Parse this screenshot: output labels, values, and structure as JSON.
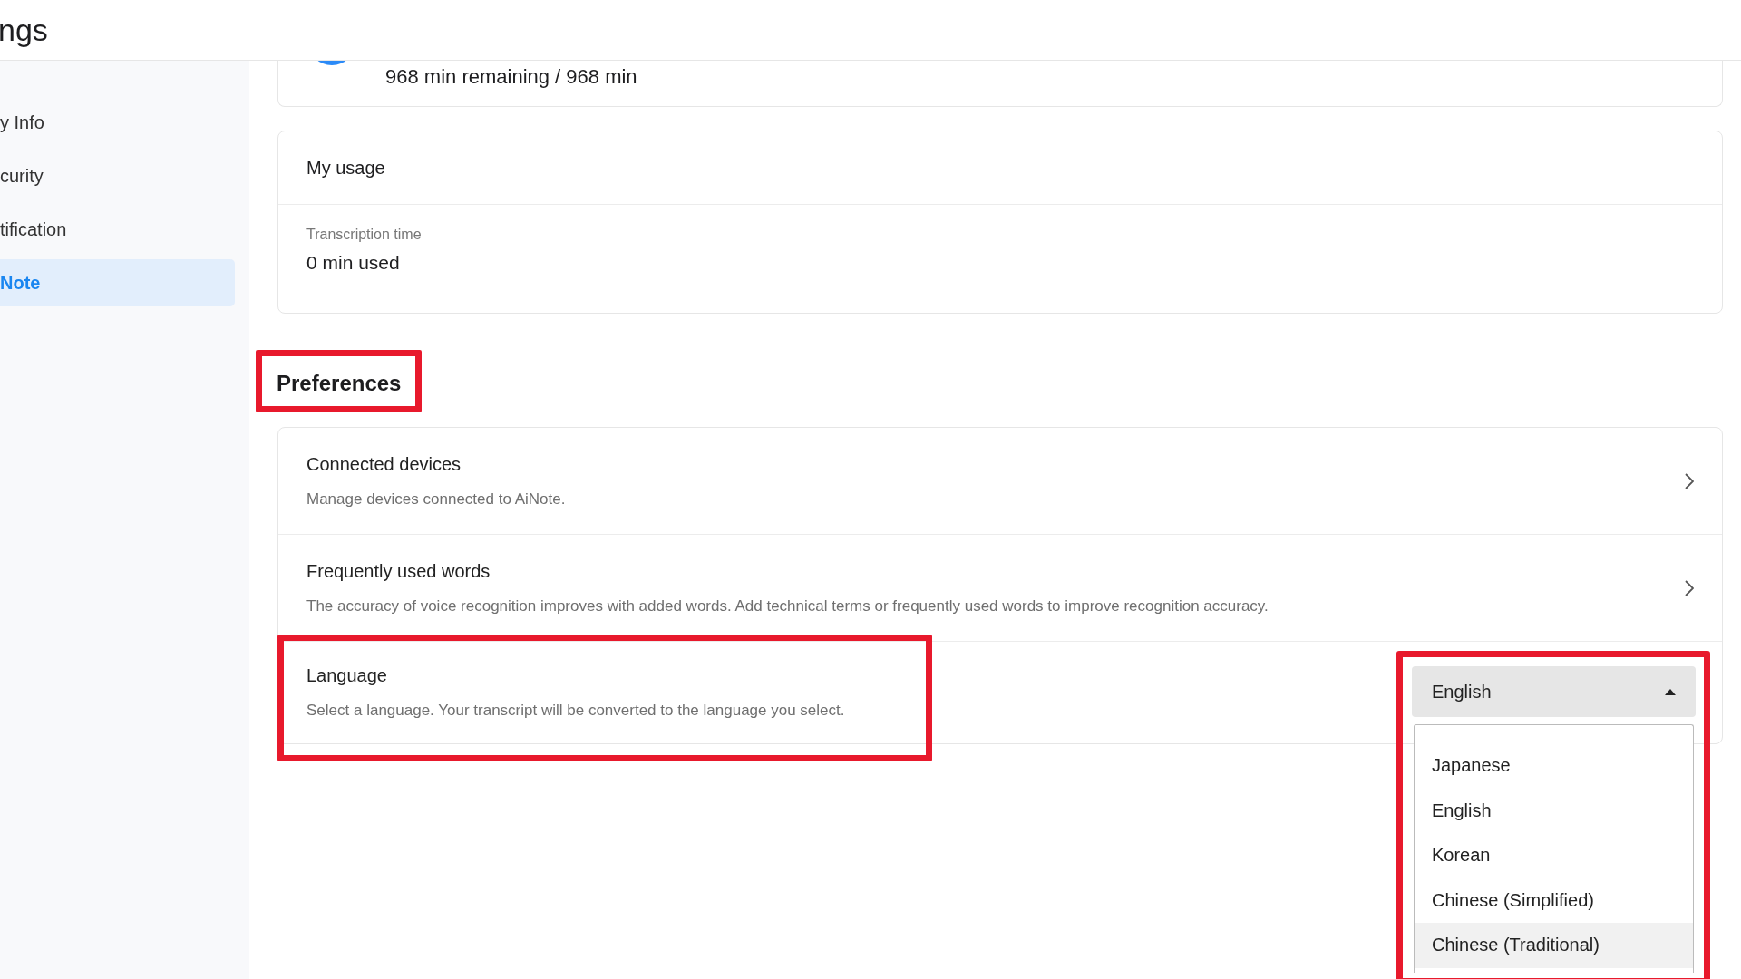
{
  "header": {
    "title": "ngs"
  },
  "sidebar": {
    "items": [
      {
        "label": "y Info",
        "selected": false
      },
      {
        "label": "curity",
        "selected": false
      },
      {
        "label": "tification",
        "selected": false
      },
      {
        "label": "Note",
        "selected": true
      }
    ]
  },
  "plan": {
    "remaining": "968 min remaining / 968 min"
  },
  "usage": {
    "title": "My usage",
    "label": "Transcription time",
    "value": "0 min used"
  },
  "preferences": {
    "heading": "Preferences",
    "annotated": true,
    "rows": [
      {
        "kind": "link",
        "title": "Connected devices",
        "description": "Manage devices connected to AiNote.",
        "annotated": false
      },
      {
        "kind": "link",
        "title": "Frequently used words",
        "description": "The accuracy of voice recognition improves with added words. Add technical terms or frequently used words to improve recognition accuracy.",
        "annotated": false
      },
      {
        "kind": "select",
        "title": "Language",
        "description": "Select a language. Your transcript will be converted to the language you select.",
        "annotated": true,
        "select": {
          "value": "English",
          "expanded": true,
          "annotated": true,
          "options": [
            {
              "label": "Japanese",
              "highlighted": false
            },
            {
              "label": "English",
              "highlighted": false
            },
            {
              "label": "Korean",
              "highlighted": false
            },
            {
              "label": "Chinese (Simplified)",
              "highlighted": false
            },
            {
              "label": "Chinese (Traditional)",
              "highlighted": true
            }
          ]
        }
      }
    ]
  }
}
